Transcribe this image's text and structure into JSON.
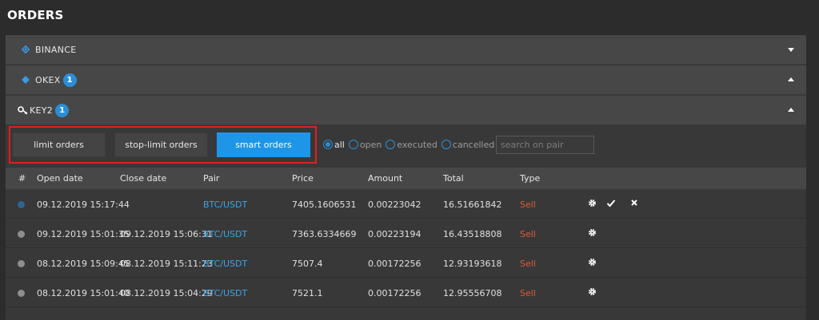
{
  "page_title": "ORDERS",
  "accounts": [
    {
      "label": "BINANCE",
      "icon": "binance-logo-icon",
      "badge": null,
      "expanded": false
    },
    {
      "label": "OKEX",
      "icon": "okex-logo-icon",
      "badge": "1",
      "expanded": true
    },
    {
      "label": "KEY2",
      "icon": "key-icon",
      "badge": "1",
      "expanded": true
    }
  ],
  "order_tabs": {
    "limit": "limit orders",
    "stop_limit": "stop-limit orders",
    "smart": "smart orders",
    "active": "smart"
  },
  "filters": {
    "all": "all",
    "open": "open",
    "executed": "executed",
    "cancelled": "cancelled",
    "selected": "all"
  },
  "search": {
    "placeholder": "search on pair",
    "value": ""
  },
  "table": {
    "headers": [
      "#",
      "Open date",
      "Close date",
      "Pair",
      "Price",
      "Amount",
      "Total",
      "Type"
    ],
    "rows": [
      {
        "open_date": "09.12.2019 15:17:44",
        "close_date": "",
        "pair": "BTC/USDT",
        "price": "7405.1606531",
        "amount": "0.00223042",
        "total": "16.51661842",
        "type": "Sell",
        "actions": [
          "gear-icon",
          "check-icon",
          "close-icon"
        ],
        "status": "active"
      },
      {
        "open_date": "09.12.2019 15:01:35",
        "close_date": "09.12.2019 15:06:31",
        "pair": "BTC/USDT",
        "price": "7363.6334669",
        "amount": "0.00223194",
        "total": "16.43518808",
        "type": "Sell",
        "actions": [
          "gear-icon"
        ],
        "status": "closed"
      },
      {
        "open_date": "08.12.2019 15:09:45",
        "close_date": "08.12.2019 15:11:23",
        "pair": "BTC/USDT",
        "price": "7507.4",
        "amount": "0.00172256",
        "total": "12.93193618",
        "type": "Sell",
        "actions": [
          "gear-icon"
        ],
        "status": "closed"
      },
      {
        "open_date": "08.12.2019 15:01:40",
        "close_date": "08.12.2019 15:04:29",
        "pair": "BTC/USDT",
        "price": "7521.1",
        "amount": "0.00172256",
        "total": "12.95556708",
        "type": "Sell",
        "actions": [
          "gear-icon"
        ],
        "status": "closed"
      }
    ]
  },
  "colors": {
    "accent": "#1e96e8",
    "highlight_outline": "#e01f1f",
    "sell": "#e05a3a",
    "pair_link": "#3fa3e6"
  }
}
